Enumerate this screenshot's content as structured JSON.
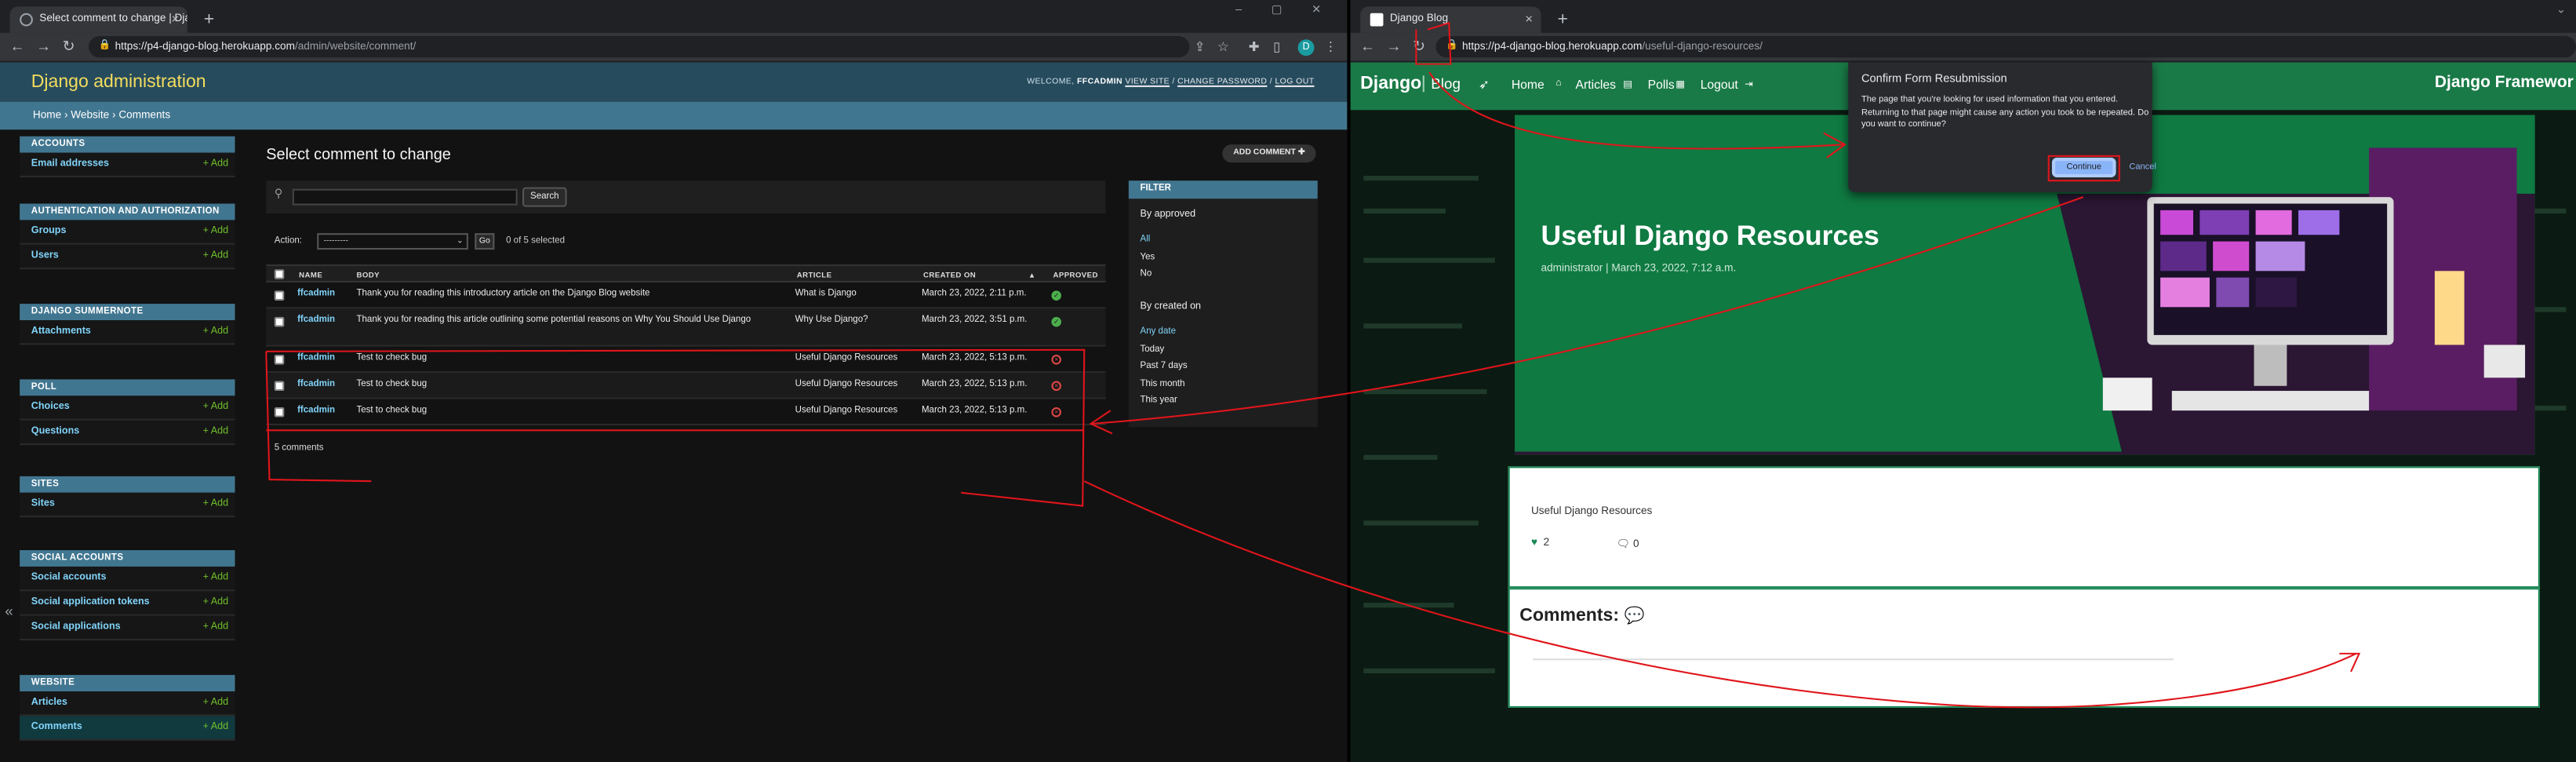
{
  "left_window": {
    "tab_title": "Select comment to change | Dja…",
    "new_tab": "+",
    "window_controls": "–  ▢  ✕",
    "url_host": "https://p4-django-blog.herokuapp.com",
    "url_path": "/admin/website/comment/",
    "avatar_letter": "D"
  },
  "right_window": {
    "tab_title": "Django Blog",
    "new_tab": "+",
    "url_host": "https://p4-django-blog.herokuapp.com",
    "url_path": "/useful-django-resources/"
  },
  "admin": {
    "brand": "Django administration",
    "welcome": "WELCOME,",
    "username": "FFCADMIN",
    "view_site": "VIEW SITE",
    "sep1": " / ",
    "change_password": "CHANGE PASSWORD",
    "sep2": " / ",
    "log_out": "LOG OUT",
    "breadcrumbs": "Home › Website › Comments",
    "page_title": "Select comment to change",
    "add_button": "ADD COMMENT",
    "search_button": "Search",
    "action_label": "Action:",
    "action_value": "---------",
    "go_button": "Go",
    "selected_count": "0 of 5 selected",
    "columns": {
      "name": "NAME",
      "body": "BODY",
      "article": "ARTICLE",
      "created_on": "CREATED ON",
      "approved": "APPROVED"
    },
    "rows": [
      {
        "name": "ffcadmin",
        "body": "Thank you for reading this introductory article on the Django Blog website",
        "article": "What is Django",
        "created_on": "March 23, 2022, 2:11 p.m.",
        "approved": true
      },
      {
        "name": "ffcadmin",
        "body": "Thank you for reading this article outlining some potential reasons on Why You Should Use Django",
        "article": "Why Use Django?",
        "created_on": "March 23, 2022, 3:51 p.m.",
        "approved": true
      },
      {
        "name": "ffcadmin",
        "body": "Test to check bug",
        "article": "Useful Django Resources",
        "created_on": "March 23, 2022, 5:13 p.m.",
        "approved": false
      },
      {
        "name": "ffcadmin",
        "body": "Test to check bug",
        "article": "Useful Django Resources",
        "created_on": "March 23, 2022, 5:13 p.m.",
        "approved": false
      },
      {
        "name": "ffcadmin",
        "body": "Test to check bug",
        "article": "Useful Django Resources",
        "created_on": "March 23, 2022, 5:13 p.m.",
        "approved": false
      }
    ],
    "result_count": "5 comments",
    "filter": {
      "title": "FILTER",
      "by_approved": "By approved",
      "approved_options": [
        "All",
        "Yes",
        "No"
      ],
      "by_created": "By created on",
      "created_options": [
        "Any date",
        "Today",
        "Past 7 days",
        "This month",
        "This year"
      ]
    },
    "add_label": "Add",
    "collapse": "«",
    "sidebar": [
      {
        "caption": "ACCOUNTS",
        "items": [
          "Email addresses"
        ]
      },
      {
        "caption": "AUTHENTICATION AND AUTHORIZATION",
        "items": [
          "Groups",
          "Users"
        ]
      },
      {
        "caption": "DJANGO SUMMERNOTE",
        "items": [
          "Attachments"
        ]
      },
      {
        "caption": "POLL",
        "items": [
          "Choices",
          "Questions"
        ]
      },
      {
        "caption": "SITES",
        "items": [
          "Sites"
        ]
      },
      {
        "caption": "SOCIAL ACCOUNTS",
        "items": [
          "Social accounts",
          "Social application tokens",
          "Social applications"
        ]
      },
      {
        "caption": "WEBSITE",
        "items": [
          "Articles",
          "Comments"
        ]
      }
    ]
  },
  "blog": {
    "brand": "Django",
    "brand_sub": "Blog",
    "nav": [
      "Home",
      "Articles",
      "Polls",
      "Logout"
    ],
    "right_brand": "Django Framewor",
    "post_title": "Useful Django Resources",
    "post_meta": "administrator | March 23, 2022, 7:12 a.m.",
    "card_title": "Useful Django Resources",
    "likes": "2",
    "comments_count": "0",
    "comments_heading": "Comments:"
  },
  "dialog": {
    "title": "Confirm Form Resubmission",
    "message": "The page that you're looking for used information that you entered. Returning to that page might cause any action you took to be repeated. Do you want to continue?",
    "continue": "Continue",
    "cancel": "Cancel"
  },
  "colors": {
    "admin_header": "#264b5d",
    "admin_link": "#81d4fa",
    "brand_yellow": "#f5dd5d",
    "blog_green": "#1a7a47",
    "annotation_red": "#e0151b"
  }
}
